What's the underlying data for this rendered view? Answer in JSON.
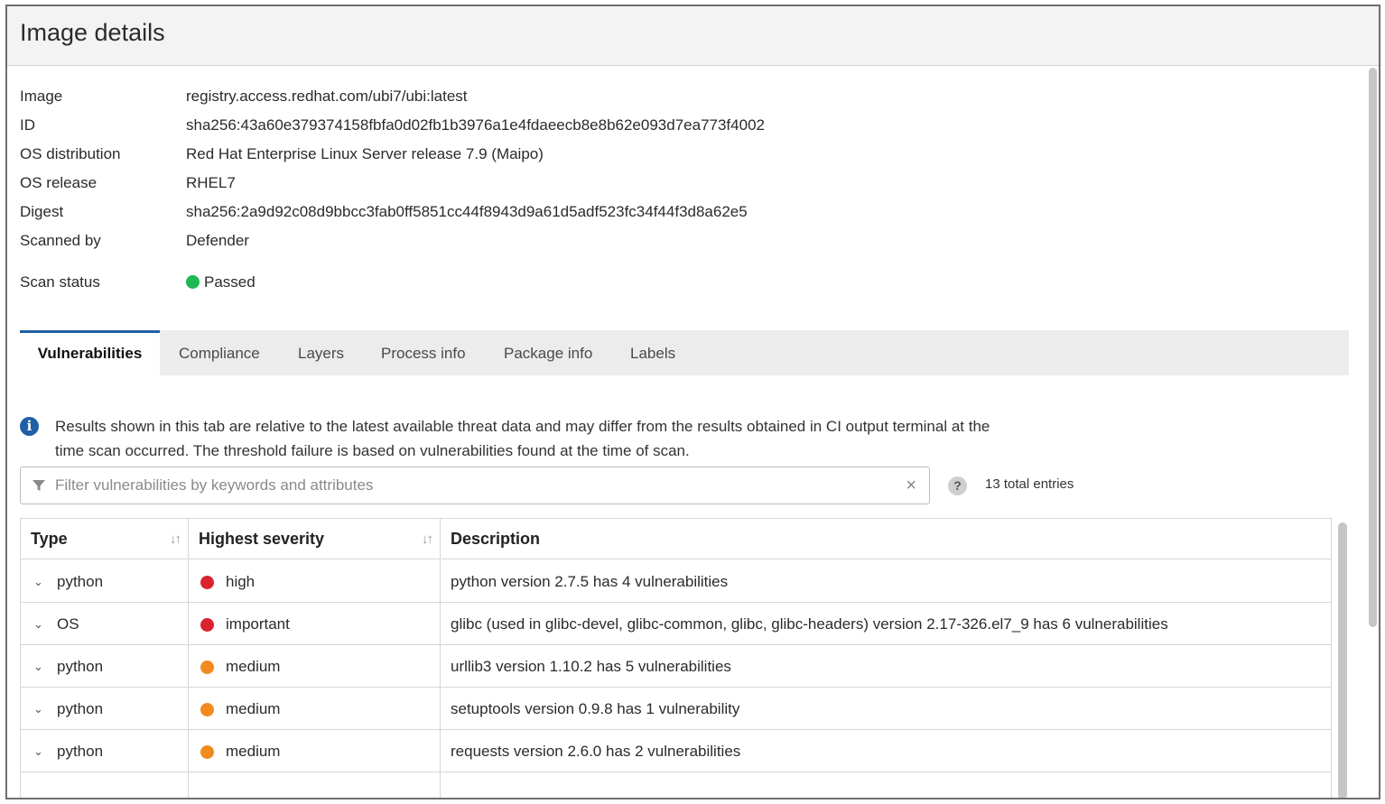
{
  "header": {
    "title": "Image details"
  },
  "details": [
    {
      "label": "Image",
      "value": "registry.access.redhat.com/ubi7/ubi:latest"
    },
    {
      "label": "ID",
      "value": "sha256:43a60e379374158fbfa0d02fb1b3976a1e4fdaeecb8e8b62e093d7ea773f4002"
    },
    {
      "label": "OS distribution",
      "value": "Red Hat Enterprise Linux Server release 7.9 (Maipo)"
    },
    {
      "label": "OS release",
      "value": "RHEL7"
    },
    {
      "label": "Digest",
      "value": "sha256:2a9d92c08d9bbcc3fab0ff5851cc44f8943d9a61d5adf523fc34f44f3d8a62e5"
    },
    {
      "label": "Scanned by",
      "value": "Defender"
    },
    {
      "label": "Scan status",
      "value": "Passed"
    }
  ],
  "status_color": "#1db954",
  "tabs": [
    "Vulnerabilities",
    "Compliance",
    "Layers",
    "Process info",
    "Package info",
    "Labels"
  ],
  "active_tab": "Vulnerabilities",
  "info": {
    "icon": "info-icon",
    "text": "Results shown in this tab are relative to the latest available threat data and may differ from the results obtained in CI output terminal at the time scan occurred. The threshold failure is based on vulnerabilities found at the time of scan."
  },
  "filter": {
    "placeholder": "Filter vulnerabilities by keywords and attributes",
    "value": ""
  },
  "total_entries": "13 total entries",
  "table": {
    "columns": [
      "Type",
      "Highest severity",
      "Description"
    ],
    "rows": [
      {
        "type": "python",
        "severity": "high",
        "severity_color": "#d9232e",
        "description": "python version 2.7.5 has 4 vulnerabilities"
      },
      {
        "type": "OS",
        "severity": "important",
        "severity_color": "#d9232e",
        "description": "glibc (used in glibc-devel, glibc-common, glibc, glibc-headers) version 2.17-326.el7_9 has 6 vulnerabilities"
      },
      {
        "type": "python",
        "severity": "medium",
        "severity_color": "#f28a1e",
        "description": "urllib3 version 1.10.2 has 5 vulnerabilities"
      },
      {
        "type": "python",
        "severity": "medium",
        "severity_color": "#f28a1e",
        "description": "setuptools version 0.9.8 has 1 vulnerability"
      },
      {
        "type": "python",
        "severity": "medium",
        "severity_color": "#f28a1e",
        "description": "requests version 2.6.0 has 2 vulnerabilities"
      }
    ]
  }
}
